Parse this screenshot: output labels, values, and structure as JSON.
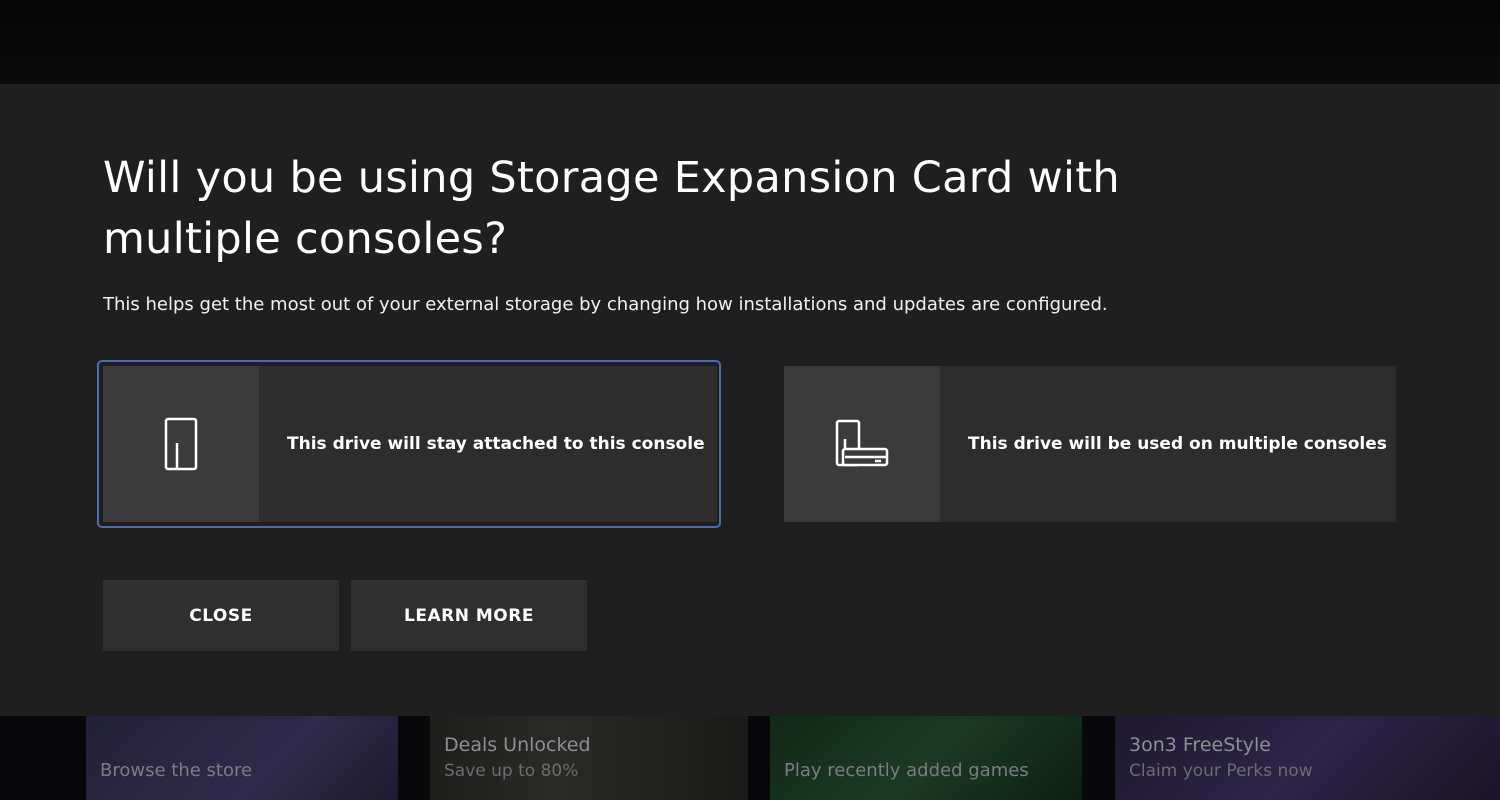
{
  "dialog": {
    "title": "Will you be using Storage Expansion Card with multiple consoles?",
    "description": "This helps get the most out of your external storage by changing how installations and updates are configured.",
    "options": [
      {
        "label": "This drive will stay attached to this console",
        "icon": "console-icon",
        "focused": true
      },
      {
        "label": "This drive will be used on multiple consoles",
        "icon": "multiple-consoles-icon",
        "focused": false
      }
    ],
    "buttons": {
      "close_label": "CLOSE",
      "learn_more_label": "LEARN MORE"
    },
    "colors": {
      "dialog_background": "#1f1f1f",
      "option_background": "#2d2d2d",
      "icon_box_background": "#3b3b3b",
      "focus_border": "#4a6cb0"
    }
  },
  "background_tiles": [
    {
      "title": "Browse the store"
    },
    {
      "title": "Deals Unlocked",
      "subtitle": "Save up to 80%"
    },
    {
      "title": "Play recently added games"
    },
    {
      "title": "3on3 FreeStyle",
      "subtitle": "Claim your Perks now"
    }
  ]
}
